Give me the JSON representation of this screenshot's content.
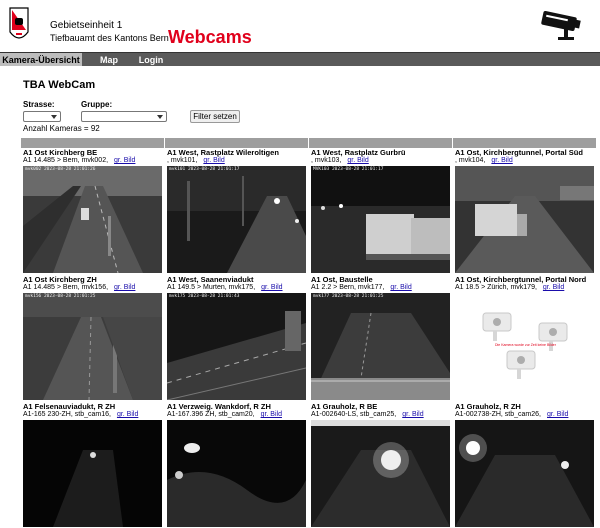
{
  "header": {
    "org_line1": "Gebietseinheit 1",
    "org_line2": "Tiefbauamt des Kantons Bern",
    "brand": "Webcams"
  },
  "nav": {
    "items": [
      {
        "label": "Kamera-Übersicht",
        "active": true
      },
      {
        "label": "Map",
        "active": false
      },
      {
        "label": "Login",
        "active": false
      }
    ]
  },
  "main": {
    "title": "TBA WebCam",
    "strasse_label": "Strasse:",
    "gruppe_label": "Gruppe:",
    "filter_button": "Filter setzen",
    "count_text": "Anzahl Kameras = 92"
  },
  "cameras": [
    {
      "title": "A1 Ost Kirchberg BE",
      "sub": "A1 14.485 > Bern, mvk002,",
      "link": "gr. Bild",
      "stamp": "mvk002 2023-08-28 21:01:26"
    },
    {
      "title": "A1 West, Rastplatz Wileroltigen",
      "sub": ", mvk101,",
      "link": "gr. Bild",
      "stamp": "mvk101 2023-08-28 21:01:17"
    },
    {
      "title": "A1 West, Rastplatz Gurbrü",
      "sub": ", mvk103,",
      "link": "gr. Bild",
      "stamp": "MVK103  2023-08-28  21:01:17"
    },
    {
      "title": "A1 Ost, Kirchbergtunnel, Portal Süd",
      "sub": ", mvk104,",
      "link": "gr. Bild",
      "stamp": ""
    },
    {
      "title": "A1 Ost Kirchberg ZH",
      "sub": "A1 14.485 > Bern, mvk156,",
      "link": "gr. Bild",
      "stamp": "mvk156 2023-08-28 21:01:25"
    },
    {
      "title": "A1 West, Saanenviadukt",
      "sub": "A1 149.5 > Murten, mvk175,",
      "link": "gr. Bild",
      "stamp": "mvk175  2023-08-28  21:01:43"
    },
    {
      "title": "A1 Ost, Baustelle",
      "sub": "A1 2.2 > Bern, mvk177,",
      "link": "gr. Bild",
      "stamp": "mvk177 2023-08-28 21:01:25"
    },
    {
      "title": "A1 Ost, Kirchbergtunnel, Portal Nord",
      "sub": "A1 18.5 > Zürich, mvk179,",
      "link": "gr. Bild",
      "stamp": "",
      "notice": "Die Kamera wurde zur Zeit keine Bilder"
    },
    {
      "title": "A1 Felsenauviadukt, R ZH",
      "sub": "A1-165 230-ZH, stb_cam16,",
      "link": "gr. Bild",
      "stamp": ""
    },
    {
      "title": "A1 Verzweig. Wankdorf, R ZH",
      "sub": "A1-167.396 ZH, stb_cam20,",
      "link": "gr. Bild",
      "stamp": ""
    },
    {
      "title": "A1 Grauholz, R BE",
      "sub": "A1-002640-LS, stb_cam25,",
      "link": "gr. Bild",
      "stamp": ""
    },
    {
      "title": "A1 Grauholz, R ZH",
      "sub": "A1-002738-ZH, stb_cam26,",
      "link": "gr. Bild",
      "stamp": ""
    }
  ]
}
